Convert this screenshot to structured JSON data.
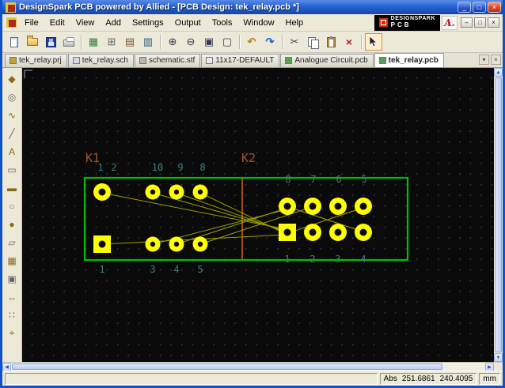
{
  "window": {
    "title": "DesignSpark PCB powered by Allied - [PCB Design: tek_relay.pcb *]",
    "controls": {
      "minimize": "_",
      "maximize": "□",
      "close": "×"
    }
  },
  "menu": {
    "items": [
      "File",
      "Edit",
      "View",
      "Add",
      "Settings",
      "Output",
      "Tools",
      "Window",
      "Help"
    ],
    "mdi_controls": {
      "minimize": "–",
      "restore": "□",
      "close": "×"
    }
  },
  "brand": {
    "name": "DESIGNSPARK",
    "product": "PCB",
    "allied": "A."
  },
  "toolbar": {
    "items": [
      {
        "name": "new-button"
      },
      {
        "name": "open-button"
      },
      {
        "name": "save-button"
      },
      {
        "name": "print-button"
      },
      {
        "name": "grid-button",
        "glyph": "▦"
      },
      {
        "name": "snap-button",
        "glyph": "⊞"
      },
      {
        "name": "layers-button",
        "glyph": "▤"
      },
      {
        "name": "design-browser-button",
        "glyph": "▥"
      },
      {
        "name": "zoom-in-button",
        "glyph": "⊕"
      },
      {
        "name": "zoom-out-button",
        "glyph": "⊖"
      },
      {
        "name": "zoom-window-button",
        "glyph": "▣"
      },
      {
        "name": "zoom-all-button",
        "glyph": "▢"
      },
      {
        "name": "undo-button",
        "glyph": "↶"
      },
      {
        "name": "redo-button",
        "glyph": "↷"
      },
      {
        "name": "cut-button",
        "glyph": "✂"
      },
      {
        "name": "copy-button"
      },
      {
        "name": "paste-button"
      },
      {
        "name": "delete-button",
        "glyph": "×"
      },
      {
        "name": "select-pointer-button"
      }
    ]
  },
  "tabs": [
    {
      "label": "tek_relay.prj",
      "active": false
    },
    {
      "label": "tek_relay.sch",
      "active": false
    },
    {
      "label": "schematic.stf",
      "active": false
    },
    {
      "label": "11x17-DEFAULT",
      "active": false
    },
    {
      "label": "Analogue Circuit.pcb",
      "active": false
    },
    {
      "label": "tek_relay.pcb",
      "active": true
    }
  ],
  "tabbar_controls": {
    "menu": "▾",
    "close": "×"
  },
  "side_toolbar": {
    "items": [
      {
        "name": "component-tool",
        "glyph": "◆"
      },
      {
        "name": "pad-tool",
        "glyph": "◎"
      },
      {
        "name": "track-tool",
        "glyph": "∿"
      },
      {
        "name": "line-tool",
        "glyph": "╱"
      },
      {
        "name": "text-tool",
        "glyph": "A"
      },
      {
        "name": "rectangle-tool",
        "glyph": "▭"
      },
      {
        "name": "filled-rectangle-tool",
        "glyph": "▬"
      },
      {
        "name": "circle-tool",
        "glyph": "○"
      },
      {
        "name": "filled-circle-tool",
        "glyph": "●"
      },
      {
        "name": "polygon-tool",
        "glyph": "▱"
      },
      {
        "name": "copper-pour-tool",
        "glyph": "▦"
      },
      {
        "name": "board-outline-tool",
        "glyph": "▣"
      },
      {
        "name": "dimension-tool",
        "glyph": "↔"
      },
      {
        "name": "array-tool",
        "glyph": "∷"
      },
      {
        "name": "origin-tool",
        "glyph": "⌖"
      }
    ]
  },
  "scrollbar": {
    "up": "▲",
    "down": "▼",
    "left": "◀",
    "right": "▶"
  },
  "statusbar": {
    "mode": "Abs",
    "x": "251.6861",
    "y": "240.4095",
    "units": "mm"
  },
  "pcb": {
    "components": [
      {
        "ref": "K1"
      },
      {
        "ref": "K2"
      }
    ],
    "pin_numbers": {
      "top_left": [
        "1",
        "2"
      ],
      "top_mid": [
        "10",
        "9",
        "8"
      ],
      "top_right": [
        "8",
        "7",
        "6",
        "5"
      ],
      "bottom_left": [
        "1"
      ],
      "bottom_mid": [
        "3",
        "4",
        "5"
      ],
      "bottom_right": [
        "1",
        "2",
        "3",
        "4"
      ]
    },
    "colors": {
      "background": "#0A0A0A",
      "grid_dot": "#282828",
      "board_outline": "#00BE00",
      "pad": "#FFFF00",
      "ratsnest": "#A6A600",
      "silkscreen": "#A34E10",
      "pin_text": "#3D8080"
    }
  }
}
